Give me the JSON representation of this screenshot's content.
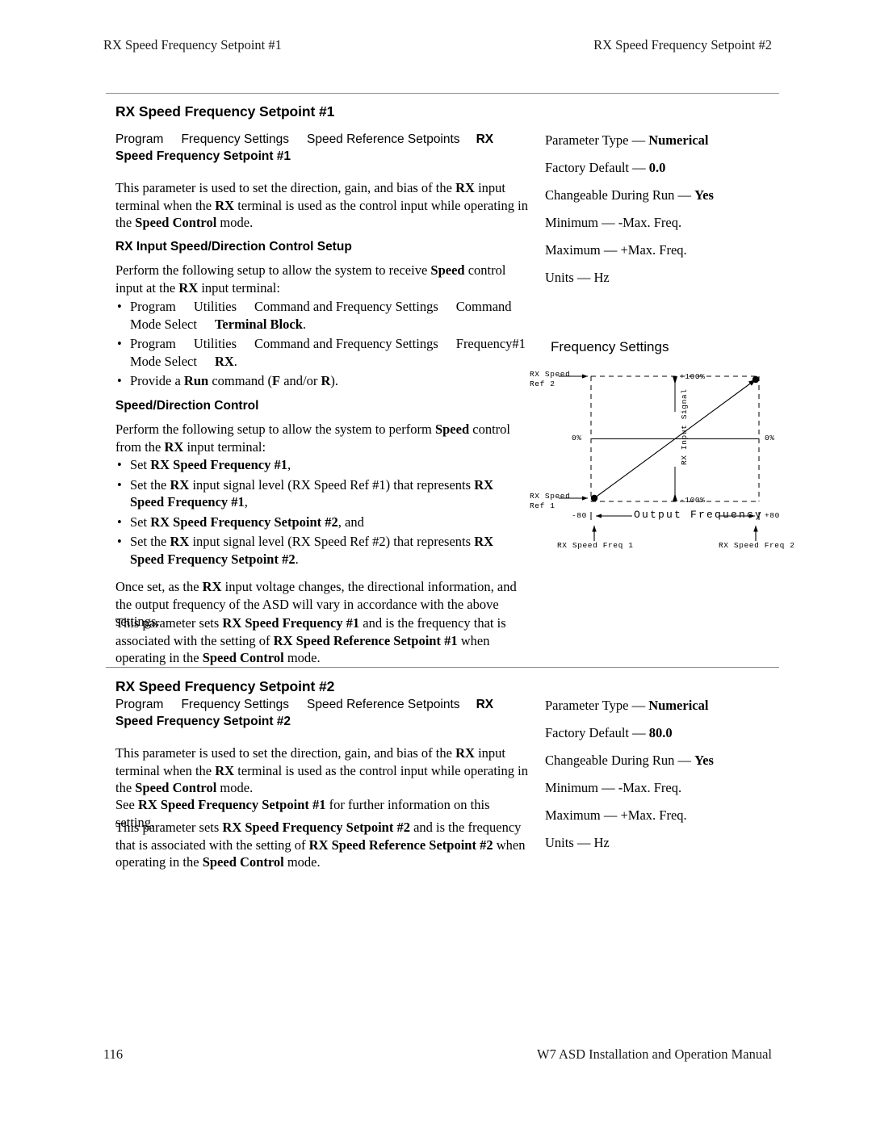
{
  "header": {
    "left": "RX Speed Frequency Setpoint #1",
    "right": "RX Speed Frequency Setpoint #2"
  },
  "footer": {
    "page_number": "116",
    "manual_title": "W7 ASD Installation and Operation Manual"
  },
  "section1": {
    "title": "RX Speed Frequency Setpoint #1",
    "breadcrumb": {
      "item1": "Program",
      "item2": "Frequency Settings",
      "item3": "Speed Reference Setpoints",
      "item4_bold": "RX Speed Frequency Setpoint #1"
    },
    "intro": {
      "t1": "This parameter is used to set the direction, gain, and bias of the ",
      "b1": "RX",
      "t2": " input terminal when the ",
      "b2": "RX",
      "t3": " terminal is used as the control input while operating in the ",
      "b3": "Speed Control",
      "t4": " mode."
    },
    "setup_heading": "RX Input Speed/Direction Control Setup",
    "setup_intro": {
      "t1": "Perform the following setup to allow the system to receive ",
      "b1": "Speed",
      "t2": " control input at the ",
      "b2": "RX",
      "t3": " input terminal:"
    },
    "setup_bullets": [
      {
        "t1": "Program",
        "t2": "Utilities",
        "t3": "Command and Frequency Settings",
        "t4": "Command Mode Select",
        "b1": "Terminal Block",
        "t5": "."
      },
      {
        "t1": "Program",
        "t2": "Utilities",
        "t3": "Command and Frequency Settings",
        "t4": "Frequency#1 Mode Select",
        "b1": "RX",
        "t5": "."
      }
    ],
    "run_bullet": {
      "t1": "Provide a ",
      "b1": "Run",
      "t2": " command (",
      "b2": "F",
      "t3": " and/or ",
      "b3": "R",
      "t4": ")."
    },
    "control_heading": "Speed/Direction Control",
    "control_intro": {
      "t1": "Perform the following setup to allow the system to perform ",
      "b1": "Speed",
      "t2": " control from the ",
      "b2": "RX",
      "t3": " input terminal:"
    },
    "control_bullets": [
      {
        "t1": "Set ",
        "b1": "RX Speed Frequency #1",
        "t2": ","
      },
      {
        "t1": "Set the ",
        "b1": "RX",
        "t2": " input signal level (RX Speed Ref #1) that represents ",
        "b2": "RX Speed Frequency #1",
        "t3": ","
      },
      {
        "t1": "Set ",
        "b1": "RX Speed Frequency Setpoint #2",
        "t2": ", and"
      },
      {
        "t1": "Set the ",
        "b1": "RX",
        "t2": " input signal level (RX Speed Ref #2) that represents ",
        "b2": "RX Speed Frequency Setpoint #2",
        "t3": "."
      }
    ],
    "closing1": {
      "t1": "Once set, as the ",
      "b1": "RX",
      "t2": " input voltage changes, the directional information, and the output frequency of the ASD will vary in accordance with the above settings."
    },
    "closing2": {
      "t1": "This parameter sets ",
      "b1": "RX Speed Frequency #1",
      "t2": " and is the frequency that is associated with the setting of ",
      "b2": "RX Speed Reference Setpoint #1",
      "t3": " when operating in the ",
      "b3": "Speed Control",
      "t4": " mode."
    },
    "spec": [
      {
        "label": "Parameter Type — ",
        "value": "Numerical",
        "bold": true
      },
      {
        "label": "Factory Default — ",
        "value": "0.0",
        "bold": true
      },
      {
        "label": "Changeable During Run — ",
        "value": "Yes",
        "bold": true
      },
      {
        "label": "Minimum — ",
        "value": "-Max. Freq.",
        "bold": false
      },
      {
        "label": "Maximum — ",
        "value": "+Max. Freq.",
        "bold": false
      },
      {
        "label": "Units — ",
        "value": "Hz",
        "bold": false
      }
    ]
  },
  "section2": {
    "title": "RX Speed Frequency Setpoint #2",
    "breadcrumb": {
      "item1": "Program",
      "item2": "Frequency Settings",
      "item3": "Speed Reference Setpoints",
      "item4_bold": "RX Speed Frequency Setpoint #2"
    },
    "intro": {
      "t1": "This parameter is used to set the direction, gain, and bias of the ",
      "b1": "RX",
      "t2": " input terminal when the ",
      "b2": "RX",
      "t3": " terminal is used as the control input while operating in the ",
      "b3": "Speed Control",
      "t4": " mode."
    },
    "see_also": {
      "t1": "See ",
      "b1": "RX Speed Frequency Setpoint #1",
      "t2": " for further information on this setting."
    },
    "closing": {
      "t1": "This parameter sets ",
      "b1": "RX Speed Frequency Setpoint #2",
      "t2": " and is the frequency that is associated with the setting of ",
      "b2": "RX Speed Reference Setpoint #2",
      "t3": " when operating in the ",
      "b3": "Speed Control",
      "t4": " mode."
    },
    "spec": [
      {
        "label": "Parameter Type — ",
        "value": "Numerical",
        "bold": true
      },
      {
        "label": "Factory Default — ",
        "value": "80.0",
        "bold": true
      },
      {
        "label": "Changeable During Run — ",
        "value": "Yes",
        "bold": true
      },
      {
        "label": "Minimum — ",
        "value": "-Max. Freq.",
        "bold": false
      },
      {
        "label": "Maximum — ",
        "value": "+Max. Freq.",
        "bold": false
      },
      {
        "label": "Units — ",
        "value": "Hz",
        "bold": false
      }
    ]
  },
  "diagram": {
    "title": "Frequency Settings",
    "y_axis_label": "RX Input Signal",
    "x_axis_label": "Output Frequency",
    "y_top_label": "+100%",
    "y_bottom_label": "-100%",
    "y_zero_left": "0%",
    "y_zero_right": "0%",
    "x_min_label": "-80",
    "x_max_label": "+80",
    "ref2_label_line1": "RX Speed",
    "ref2_label_line2": "Ref 2",
    "ref1_label_line1": "RX Speed",
    "ref1_label_line2": "Ref 1",
    "callout_left": "RX Speed Freq 1",
    "callout_right": "RX Speed Freq 2"
  },
  "chart_data": {
    "type": "line",
    "title": "Frequency Settings",
    "xlabel": "Output Frequency",
    "ylabel": "RX Input Signal",
    "xlim": [
      -80,
      80
    ],
    "ylim": [
      -100,
      100
    ],
    "xtick_labels": [
      "-80",
      "+80"
    ],
    "ytick_labels": [
      "-100%",
      "0%",
      "+100%"
    ],
    "grid": false,
    "series": [
      {
        "name": "RX input transfer characteristic",
        "x": [
          -80,
          80
        ],
        "y": [
          -100,
          100
        ],
        "points": [
          {
            "x": -80,
            "y": -100,
            "label": "RX Speed Ref 1 / RX Speed Freq 1"
          },
          {
            "x": 80,
            "y": 100,
            "label": "RX Speed Ref 2 / RX Speed Freq 2"
          }
        ]
      }
    ],
    "annotations": [
      "RX Speed Ref 2",
      "RX Speed Ref 1",
      "RX Speed Freq 1",
      "RX Speed Freq 2"
    ]
  }
}
